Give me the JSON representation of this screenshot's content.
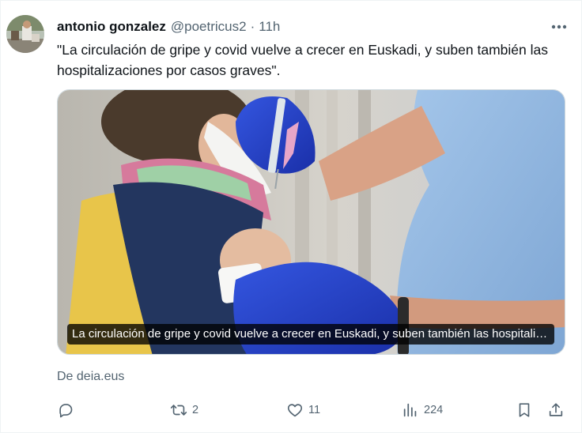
{
  "tweet": {
    "author_name": "antonio gonzalez",
    "handle": "@poetricus2",
    "separator": "·",
    "time": "11h",
    "text": "\"La circulación de gripe y covid vuelve a crecer en Euskadi, y suben también las hospitalizaciones por casos graves\".",
    "more_icon": "more-horizontal-icon"
  },
  "card": {
    "caption": "La circulación de gripe y covid vuelve a crecer en Euskadi, y suben también las hospitalizaciones por casos graves",
    "source": "De deia.eus"
  },
  "actions": {
    "reply": {
      "icon": "reply-icon",
      "count": ""
    },
    "retweet": {
      "icon": "retweet-icon",
      "count": "2"
    },
    "like": {
      "icon": "heart-icon",
      "count": "11"
    },
    "views": {
      "icon": "views-icon",
      "count": "224"
    },
    "bookmark": {
      "icon": "bookmark-icon"
    },
    "share": {
      "icon": "share-icon"
    }
  },
  "colors": {
    "text": "#0f1419",
    "secondary": "#536471",
    "glove": "#1f3fc8",
    "shirt": "#8fb7e0"
  }
}
